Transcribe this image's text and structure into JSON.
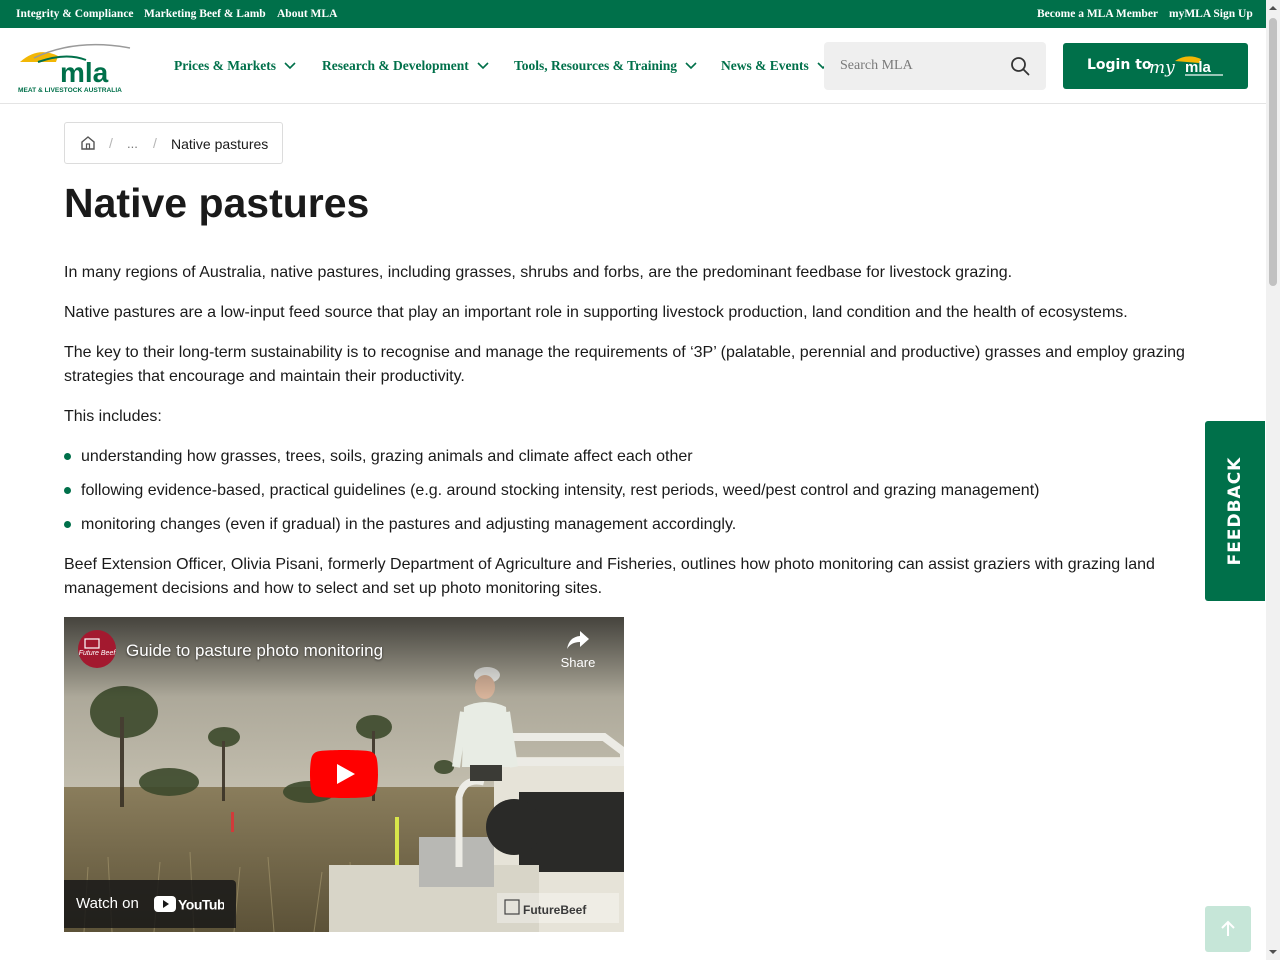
{
  "utility_bar": {
    "left_links": [
      "Integrity & Compliance",
      "Marketing Beef & Lamb",
      "About MLA"
    ],
    "right_links": [
      "Become a MLA Member",
      "myMLA Sign Up"
    ]
  },
  "header": {
    "logo_text": "mla",
    "logo_tagline": "MEAT & LIVESTOCK AUSTRALIA",
    "nav": [
      {
        "label": "Prices & Markets"
      },
      {
        "label": "Research & Development"
      },
      {
        "label": "Tools, Resources & Training"
      },
      {
        "label": "News & Events"
      }
    ],
    "search_placeholder": "Search MLA",
    "login_label": "Login to"
  },
  "breadcrumb": {
    "ellipsis": "...",
    "current": "Native pastures"
  },
  "main": {
    "title": "Native pastures",
    "paragraphs": [
      "In many regions of Australia, native pastures, including grasses, shrubs and forbs, are the predominant feedbase for livestock grazing.",
      "Native pastures are a low-input feed source that play an important role in supporting livestock production, land condition and the health of ecosystems.",
      "The key to their long-term sustainability is to recognise and manage the requirements of ‘3P’ (palatable, perennial and productive) grasses and employ grazing strategies that encourage and maintain their productivity.",
      "This includes:"
    ],
    "bullets": [
      "understanding how grasses, trees, soils, grazing animals and climate affect each other",
      "following evidence-based, practical guidelines (e.g. around stocking intensity, rest periods, weed/pest control and grazing management)",
      "monitoring changes (even if gradual) in the pastures and adjusting management accordingly."
    ],
    "after_paragraph": "Beef Extension Officer, Olivia Pisani, formerly Department of Agriculture and Fisheries, outlines how photo monitoring can assist graziers with grazing land management decisions and how to select and set up photo monitoring sites."
  },
  "video": {
    "title": "Guide to pasture photo monitoring",
    "share_label": "Share",
    "watch_on_label": "Watch on",
    "youtube_label": "YouTube",
    "watermark": "FutureBeef",
    "channel_badge": "Future Beef"
  },
  "feedback": {
    "label": "FEEDBACK"
  },
  "colors": {
    "brand_green": "#00704a",
    "logo_yellow": "#f2b705",
    "play_red": "#ff0000"
  }
}
